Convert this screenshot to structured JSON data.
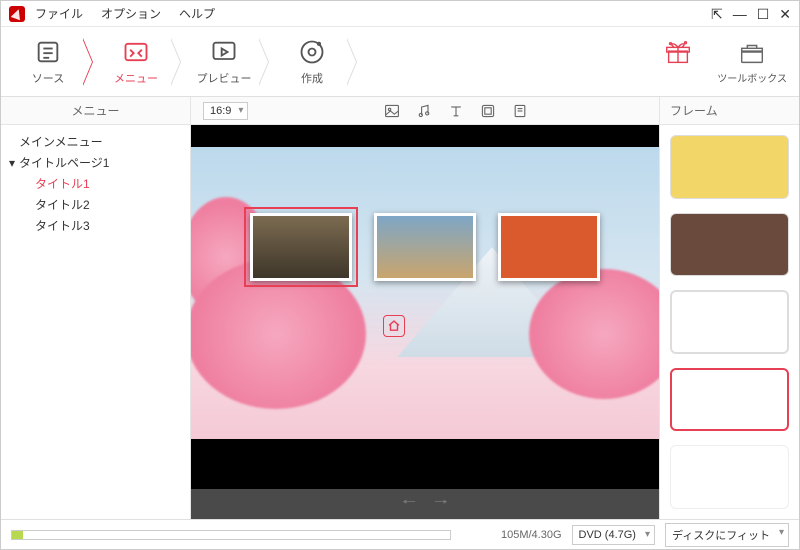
{
  "menu": {
    "file": "ファイル",
    "option": "オプション",
    "help": "ヘルプ"
  },
  "win": {
    "pin": "�ċ",
    "min": "—",
    "max": "☐",
    "close": "✕"
  },
  "steps": {
    "source": "ソース",
    "menu": "メニュー",
    "preview": "プレビュー",
    "create": "作成"
  },
  "right_tools": {
    "store": "",
    "toolbox": "ツールボックス"
  },
  "midheader": {
    "left": "メニュー",
    "right": "フレーム",
    "aspect": "16:9"
  },
  "tree": {
    "main": "メインメニュー",
    "tpage": "タイトルページ1",
    "t1": "タイトル1",
    "t2": "タイトル2",
    "t3": "タイトル3"
  },
  "status": {
    "usage": "105M/4.30G",
    "disc": "DVD (4.7G)",
    "fit": "ディスクにフィット"
  }
}
